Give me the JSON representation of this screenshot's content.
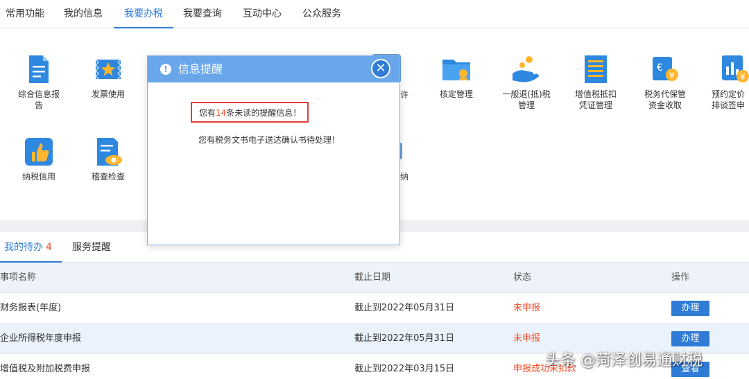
{
  "nav": {
    "tabs": [
      {
        "label": "常用功能",
        "active": false
      },
      {
        "label": "我的信息",
        "active": false
      },
      {
        "label": "我要办税",
        "active": true
      },
      {
        "label": "我要查询",
        "active": false
      },
      {
        "label": "互动中心",
        "active": false
      },
      {
        "label": "公众服务",
        "active": false
      }
    ]
  },
  "functions": {
    "row1": [
      {
        "label": "综合信息报告",
        "line1": "综合信息报",
        "line2": "告",
        "icon": "document-icon"
      },
      {
        "label": "发票使用",
        "line1": "发票使用",
        "line2": "",
        "icon": "invoice-star-icon"
      },
      {
        "label_fragment": "许",
        "icon": "partially-hidden-icon"
      },
      {
        "label": "核定管理",
        "line1": "核定管理",
        "line2": "",
        "icon": "folder-stamp-icon"
      },
      {
        "label": "一般退(抵)税管理",
        "line1": "一般退(抵)税",
        "line2": "管理",
        "icon": "hand-coin-icon"
      },
      {
        "label": "增值税抵扣凭证管理",
        "line1": "增值税抵扣",
        "line2": "凭证管理",
        "icon": "receipt-list-icon"
      },
      {
        "label": "税务代保管资金收取",
        "line1": "税务代保管",
        "line2": "资金收取",
        "icon": "tax-yen-icon"
      },
      {
        "label": "预约定价排谈签申",
        "line1": "预约定价",
        "line2": "排谈签申",
        "icon": "chart-yen-icon"
      }
    ],
    "row2": [
      {
        "label": "纳税信用",
        "line1": "纳税信用",
        "line2": "",
        "icon": "thumbs-up-icon"
      },
      {
        "label": "稽查检查",
        "line1": "稽查检查",
        "line2": "",
        "icon": "doc-eye-icon"
      },
      {
        "label_fragment": "纳",
        "icon": "partially-hidden-icon"
      }
    ]
  },
  "todo": {
    "tabs": [
      {
        "label": "我的待办",
        "count": "4",
        "active": true
      },
      {
        "label": "服务提醒",
        "count": "",
        "active": false
      }
    ],
    "columns": {
      "name": "事项名称",
      "deadline": "截止日期",
      "status": "状态",
      "action": "操作"
    },
    "rows": [
      {
        "name": "财务报表(年度)",
        "deadline": "截止到2022年05月31日",
        "status": "未申报",
        "action": "办理"
      },
      {
        "name": "企业所得税年度申报",
        "deadline": "截止到2022年05月31日",
        "status": "未申报",
        "action": "办理"
      },
      {
        "name": "增值税及附加税费申报",
        "deadline": "截止到2022年03月15日",
        "status": "申报成功未扣款",
        "action": "查看"
      }
    ]
  },
  "modal": {
    "title": "信息提醒",
    "close_symbol": "✕",
    "message1_prefix": "您有",
    "message1_count": "14",
    "message1_suffix": "条未读的提醒信息！",
    "message2": "您有税务文书电子送达确认书待处理！"
  },
  "watermark": "头条 @菏泽创易通财税",
  "colors": {
    "accent": "#2f7bd6",
    "alert": "#f0502b",
    "modal_header": "#6aa7ea"
  }
}
